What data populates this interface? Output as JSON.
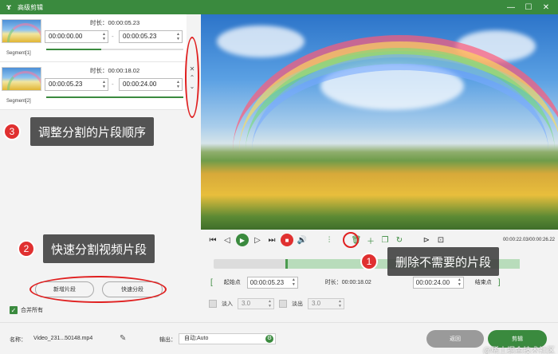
{
  "window": {
    "title": "高级剪辑",
    "minimize": "—",
    "maximize": "☐",
    "close": "✕",
    "logo": "ɤ"
  },
  "segments": [
    {
      "label": "Segment[1]",
      "duration_label": "时长：",
      "duration": "00:00:05.23",
      "start": "00:00:00.00",
      "end": "00:00:05.23",
      "progress": 0.4
    },
    {
      "label": "Segment[2]",
      "duration_label": "时长：",
      "duration": "00:00:18.02",
      "start": "00:00:05.23",
      "end": "00:00:24.00",
      "progress": 1.0
    }
  ],
  "segment_tools": {
    "delete": "✕",
    "up": "⌃",
    "down": "⌄"
  },
  "annotations": [
    {
      "num": "3",
      "text": "调整分割的片段顺序"
    },
    {
      "num": "2",
      "text": "快速分割视频片段"
    },
    {
      "num": "1",
      "text": "删除不需要的片段"
    }
  ],
  "left_buttons": {
    "new_segment": "新增片段",
    "quick_split": "快速分段"
  },
  "merge_all": {
    "label": "合并所有",
    "checked": true
  },
  "player": {
    "time_readout": "00:00:22.03/00:00:26.22",
    "start_point": "起始点",
    "start_value": "00:00:05.23",
    "duration_label": "时长：",
    "duration_value": "00:00:18.02",
    "end_value": "00:00:24.00",
    "end_point": "结束点",
    "fade_in": "淡入",
    "fade_in_value": "3.0",
    "fade_out": "淡出",
    "fade_out_value": "3.0"
  },
  "bottom": {
    "name_label": "名称：",
    "name_value": "Video_231...50148.mp4",
    "output_label": "输出：",
    "output_value": "自动;Auto",
    "back": "返回",
    "save": "剪辑",
    "watermark": "@稀土掘金技术社区"
  }
}
